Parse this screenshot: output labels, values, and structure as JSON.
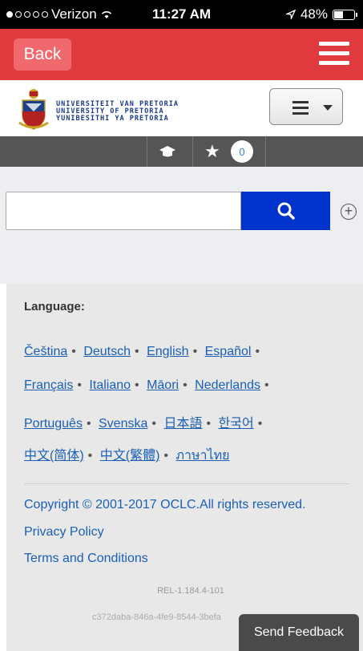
{
  "status_bar": {
    "carrier": "Verizon",
    "time": "11:27 AM",
    "battery": "48%",
    "battery_level": 0.48
  },
  "nav": {
    "back_label": "Back"
  },
  "header": {
    "logo_lines": [
      "UNIVERSITEIT VAN PRETORIA",
      "UNIVERSITY OF PRETORIA",
      "YUNIBESITHI YA PRETORIA"
    ]
  },
  "toolbar": {
    "list_count": "0"
  },
  "search": {
    "value": "",
    "placeholder": ""
  },
  "language": {
    "title": "Language:",
    "rows": [
      [
        "Čeština",
        "Deutsch",
        "English",
        "Español"
      ],
      [
        "Français",
        "Italiano",
        "Māori",
        "Nederlands"
      ],
      [
        "Português",
        "Svenska",
        "日本語",
        "한국어"
      ],
      [
        "中文(简体)",
        "中文(繁體)",
        "ภาษาไทย"
      ]
    ]
  },
  "footer": {
    "copyright": "Copyright © 2001-2017 OCLC.All rights reserved.",
    "privacy": "Privacy Policy",
    "terms": "Terms and Conditions",
    "release": "REL-1.184.4-101",
    "build_hash": "c372daba-846a-4fe9-8544-3befa"
  },
  "feedback": {
    "label": "Send Feedback"
  },
  "colors": {
    "nav_red": "#e03a3e",
    "search_blue": "#0033cc",
    "link_blue": "#1a5fb4"
  }
}
